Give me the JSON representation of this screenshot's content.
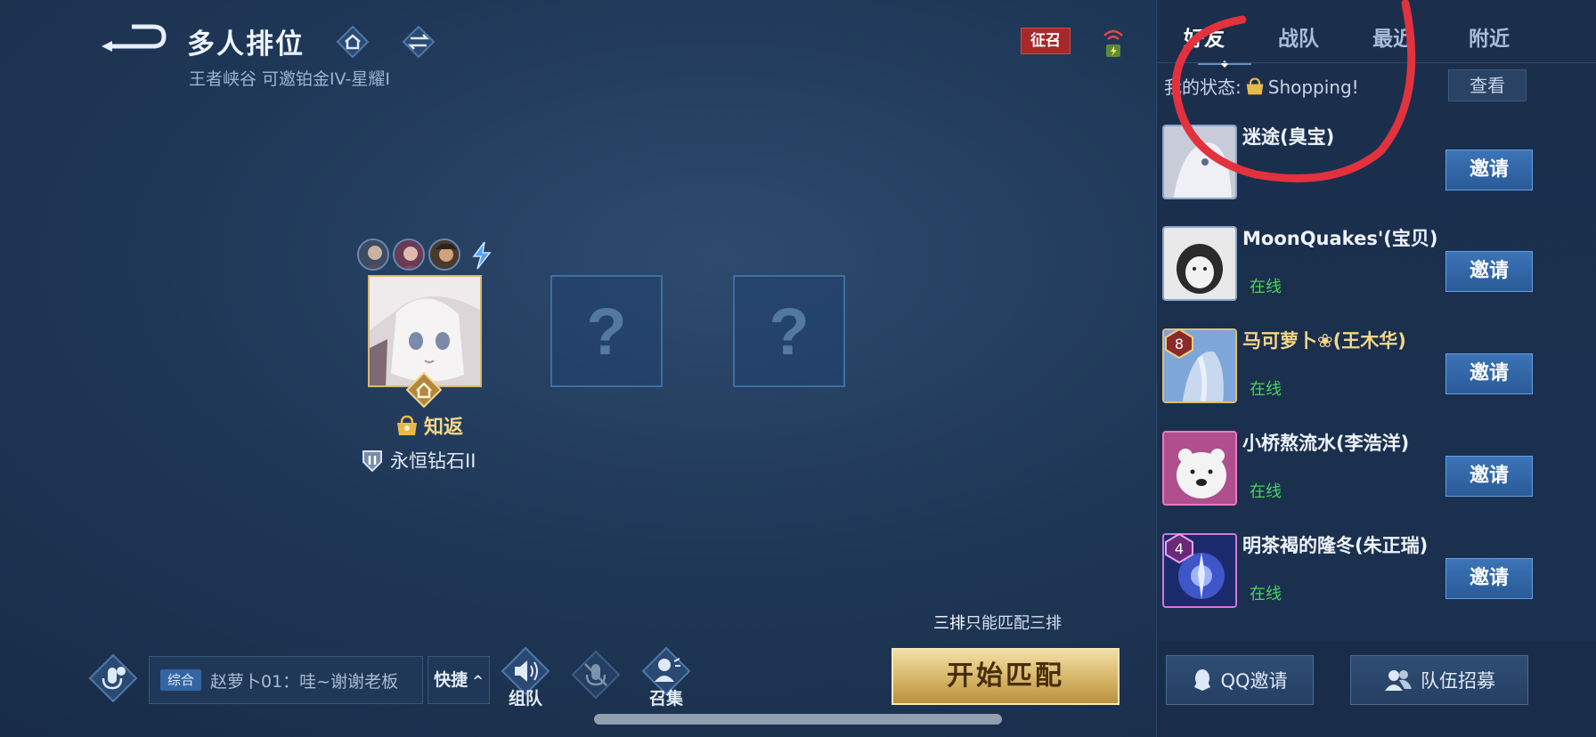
{
  "header": {
    "title": "多人排位",
    "subtitle": "王者峡谷   可邀铂金IV-星耀I",
    "recruit_badge": "征召"
  },
  "tabs": [
    {
      "label": "好友",
      "active": true
    },
    {
      "label": "战队",
      "active": false
    },
    {
      "label": "最近",
      "active": false
    },
    {
      "label": "附近",
      "active": false
    }
  ],
  "status": {
    "label": "我的状态:",
    "value": "Shopping!",
    "view_button": "查看"
  },
  "friends": [
    {
      "name": "迷途(臭宝)",
      "online": "",
      "invite": "邀请"
    },
    {
      "name": "MoonQuakes'(宝贝)",
      "online": "在线",
      "invite": "邀请"
    },
    {
      "name": "马可萝卜❀(王木华)",
      "online": "在线",
      "invite": "邀请",
      "level": "8"
    },
    {
      "name": "小桥熬流水(李浩洋)",
      "online": "在线",
      "invite": "邀请"
    },
    {
      "name": "明茶褐的隆冬(朱正瑞)",
      "online": "在线",
      "invite": "邀请",
      "level": "4"
    }
  ],
  "panel_buttons": {
    "qq_invite": "QQ邀请",
    "team_recruit": "队伍招募"
  },
  "player": {
    "name": "知返",
    "rank": "永恒钻石II"
  },
  "empty_slot_mark": "?",
  "match_note": {
    "part1": "三排",
    "part2": "只能匹配三排"
  },
  "start_button": "开始匹配",
  "chat": {
    "tag": "综合",
    "message": "赵萝卜01：哇~谢谢老板",
    "quick_button": "快捷"
  },
  "controls": {
    "team_voice": "组队",
    "summon": "召集"
  },
  "colors": {
    "online_green": "#49d35a",
    "gold_name": "#f5d58a",
    "invite_blue": "#3b74b7",
    "recruit_red": "#a8282a"
  }
}
